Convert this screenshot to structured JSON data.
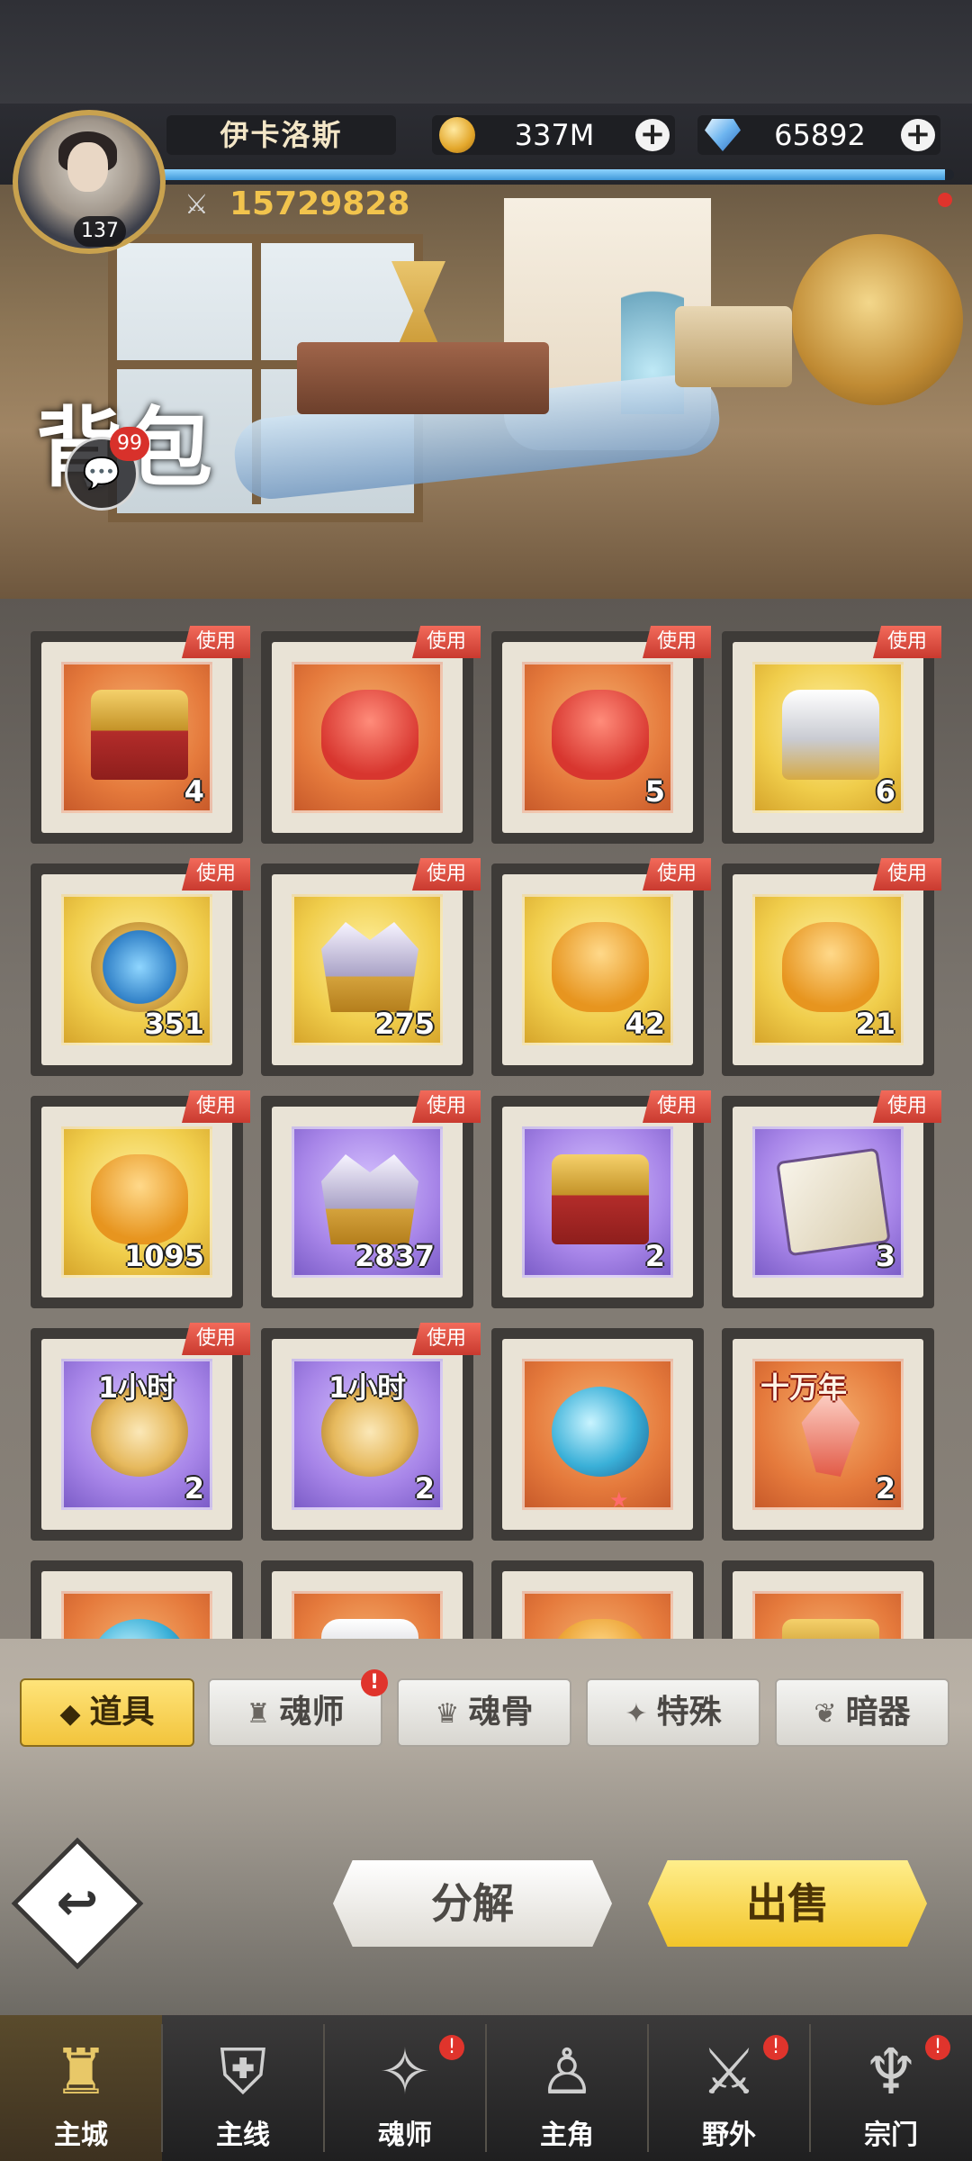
{
  "player": {
    "name": "伊卡洛斯",
    "level": "137",
    "power": "15729828",
    "exp_fraction": 0.99
  },
  "currency": {
    "gold": "337M",
    "diamonds": "65892"
  },
  "page": {
    "title": "背包",
    "chat_badge": "99"
  },
  "items": [
    {
      "rarity": "orange",
      "art": "chest",
      "count": "4",
      "use": "使用"
    },
    {
      "rarity": "orange",
      "art": "sack",
      "count": "",
      "use": "使用"
    },
    {
      "rarity": "orange",
      "art": "sack",
      "count": "5",
      "use": "使用"
    },
    {
      "rarity": "gold",
      "art": "helm",
      "count": "6",
      "use": "使用"
    },
    {
      "rarity": "gold",
      "art": "tools",
      "count": "351",
      "use": "使用"
    },
    {
      "rarity": "gold",
      "art": "crystal",
      "count": "275",
      "use": "使用"
    },
    {
      "rarity": "gold",
      "art": "sackg",
      "count": "42",
      "use": "使用"
    },
    {
      "rarity": "gold",
      "art": "sackg",
      "count": "21",
      "use": "使用"
    },
    {
      "rarity": "gold",
      "art": "sackg",
      "count": "1095",
      "use": "使用"
    },
    {
      "rarity": "purple",
      "art": "crystal",
      "count": "2837",
      "use": "使用"
    },
    {
      "rarity": "purple",
      "art": "chest",
      "count": "2",
      "use": "使用"
    },
    {
      "rarity": "purple",
      "art": "cards",
      "count": "3",
      "use": "使用"
    },
    {
      "rarity": "purple",
      "art": "watch",
      "count": "2",
      "use": "使用",
      "tag": "1小时"
    },
    {
      "rarity": "purple",
      "art": "watch",
      "count": "2",
      "use": "使用",
      "tag": "1小时"
    },
    {
      "rarity": "orange",
      "art": "orb",
      "count": "",
      "use": ""
    },
    {
      "rarity": "orange",
      "art": "shard",
      "count": "2",
      "use": "",
      "tag": "十万年"
    },
    {
      "rarity": "orange",
      "art": "orb",
      "count": "",
      "use": ""
    },
    {
      "rarity": "orange",
      "art": "helm",
      "count": "",
      "use": ""
    },
    {
      "rarity": "orange",
      "art": "sackg",
      "count": "",
      "use": ""
    },
    {
      "rarity": "orange",
      "art": "chest",
      "count": "",
      "use": ""
    }
  ],
  "tabs": [
    {
      "label": "道具",
      "active": true,
      "badge": ""
    },
    {
      "label": "魂师",
      "active": false,
      "badge": "!"
    },
    {
      "label": "魂骨",
      "active": false,
      "badge": ""
    },
    {
      "label": "特殊",
      "active": false,
      "badge": ""
    },
    {
      "label": "暗器",
      "active": false,
      "badge": ""
    }
  ],
  "actions": {
    "decompose": "分解",
    "sell": "出售"
  },
  "nav": [
    {
      "label": "主城",
      "icon": "castle-icon",
      "active": true,
      "badge": ""
    },
    {
      "label": "主线",
      "icon": "shield-icon",
      "active": false,
      "badge": ""
    },
    {
      "label": "魂师",
      "icon": "spirit-icon",
      "active": false,
      "badge": "!"
    },
    {
      "label": "主角",
      "icon": "hood-icon",
      "active": false,
      "badge": ""
    },
    {
      "label": "野外",
      "icon": "sword-shield-icon",
      "active": false,
      "badge": "!"
    },
    {
      "label": "宗门",
      "icon": "sect-icon",
      "active": false,
      "badge": "!"
    }
  ],
  "colors": {
    "accent_gold": "#f2c44d",
    "badge_red": "#e0342c",
    "exp_bar": "#3f99d9"
  }
}
